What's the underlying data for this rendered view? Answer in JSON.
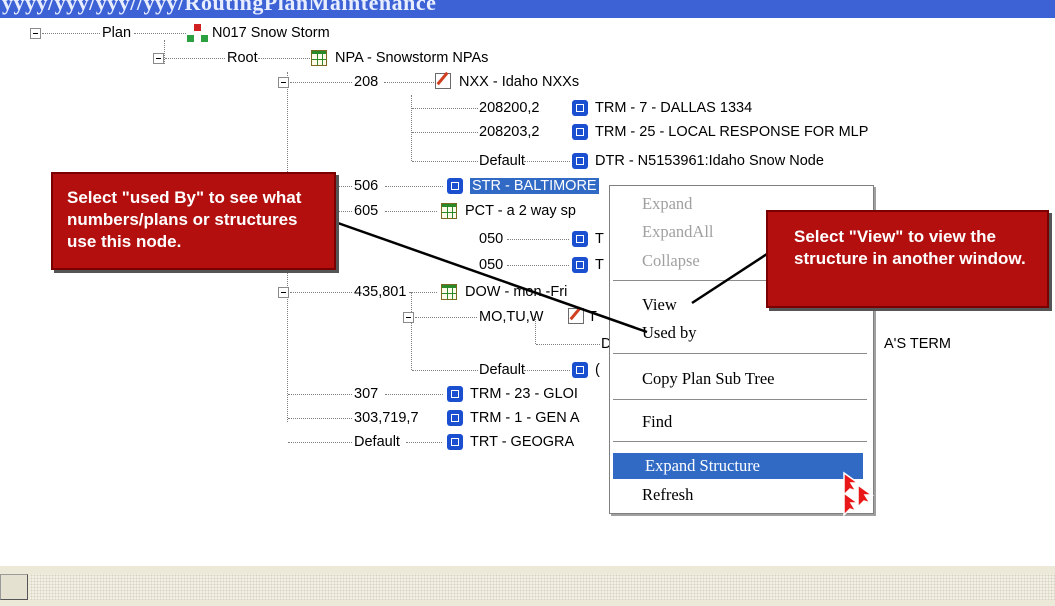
{
  "window": {
    "title": "yyyy/yyy/yyy//yyy/RoutingPlanMaintenance"
  },
  "tree": {
    "nodes": [
      {
        "key": "Plan",
        "desc": "N017  Snow Storm"
      },
      {
        "key": "Root",
        "desc": "NPA - Snowstorm NPAs"
      },
      {
        "key": "208",
        "desc": "NXX - Idaho NXXs"
      },
      {
        "key": "208200,2",
        "desc": "TRM - 7 - DALLAS 1334"
      },
      {
        "key": "208203,2",
        "desc": "TRM - 25 - LOCAL RESPONSE FOR MLP"
      },
      {
        "key": "Default",
        "desc": "DTR - N5153961:Idaho Snow Node"
      },
      {
        "key": "506",
        "desc": "STR - BALTIMORE"
      },
      {
        "key": "605",
        "desc": "PCT - a 2 way sp"
      },
      {
        "key": "050",
        "desc": "T"
      },
      {
        "key": "050",
        "desc": "T"
      },
      {
        "key": "435,801",
        "desc": "DOW - mon -Fri"
      },
      {
        "key": "MO,TU,W",
        "desc": "T"
      },
      {
        "key": "D",
        "desc": "A'S TERM"
      },
      {
        "key": "Default",
        "desc": "("
      },
      {
        "key": "307",
        "desc": "TRM - 23 - GLOI"
      },
      {
        "key": "303,719,7",
        "desc": "TRM - 1 - GEN A"
      },
      {
        "key": "Default",
        "desc": "TRT - GEOGRA"
      }
    ]
  },
  "context_menu": {
    "items": [
      {
        "label": "Expand",
        "state": "disabled"
      },
      {
        "label": "ExpandAll",
        "state": "disabled"
      },
      {
        "label": "Collapse",
        "state": "disabled"
      },
      {
        "label": "View",
        "state": "enabled"
      },
      {
        "label": "Used by",
        "state": "enabled"
      },
      {
        "label": "Copy Plan Sub Tree",
        "state": "enabled"
      },
      {
        "label": "Find",
        "state": "enabled"
      },
      {
        "label": "Expand Structure",
        "state": "highlighted"
      },
      {
        "label": "Refresh",
        "state": "enabled"
      }
    ]
  },
  "callouts": {
    "used_by": "Select \"used By\" to see what numbers/plans or structures use this node.",
    "view": "Select \"View\" to view the structure in another window."
  },
  "colors": {
    "callout_bg": "#b30f0f",
    "selection": "#316ac5",
    "title_bar": "#3d62d6",
    "structure_icon": "#1a4fd0"
  },
  "icons": [
    "plan-icon",
    "grid-icon",
    "edit-icon",
    "structure-icon",
    "mouse-pointer-icon"
  ]
}
